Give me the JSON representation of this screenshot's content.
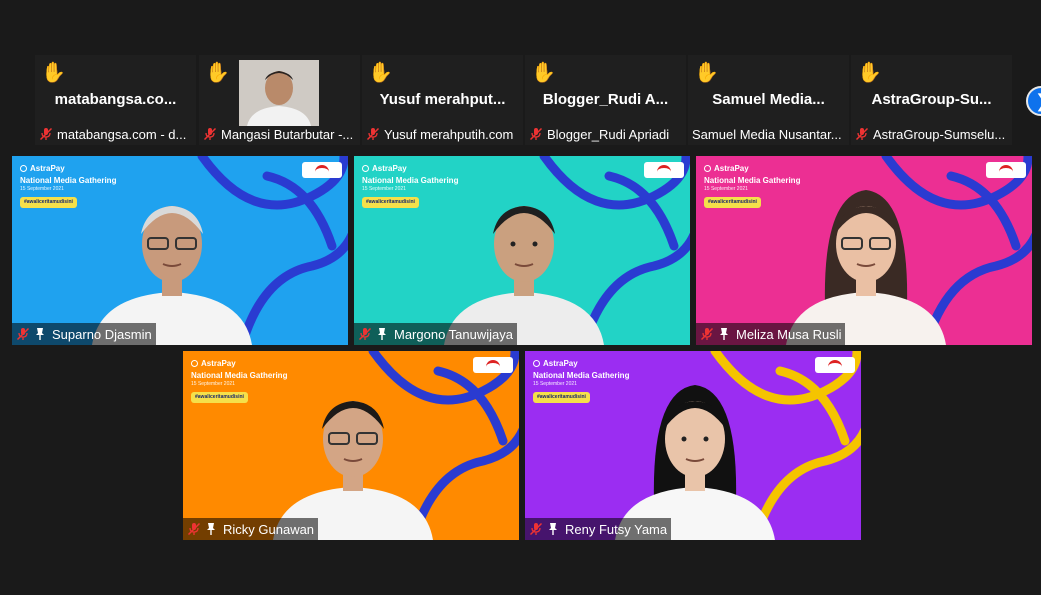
{
  "strip": [
    {
      "big_name": "matabangsa.co...",
      "label": "matabangsa.com - d...",
      "raised_hand": true,
      "has_photo": false
    },
    {
      "big_name": "",
      "label": "Mangasi Butarbutar -...",
      "raised_hand": true,
      "has_photo": true
    },
    {
      "big_name": "Yusuf  merahput...",
      "label": "Yusuf merahputih.com",
      "raised_hand": true,
      "has_photo": false
    },
    {
      "big_name": "Blogger_Rudi  A...",
      "label": "Blogger_Rudi Apriadi",
      "raised_hand": true,
      "has_photo": false
    },
    {
      "big_name": "Samuel  Media...",
      "label": "Samuel Media Nusantar...",
      "raised_hand": true,
      "has_photo": false
    },
    {
      "big_name": "AstraGroup-Su...",
      "label": "AstraGroup-Sumselu...",
      "raised_hand": true,
      "has_photo": false
    }
  ],
  "strip_muted": [
    true,
    true,
    true,
    true,
    false,
    true
  ],
  "hand_icon": "✋",
  "next_icon": "chevron-right-icon",
  "next_glyph": "❯",
  "background": {
    "brand": "AstraPay",
    "event": "National Media Gathering",
    "date": "15 September 2021",
    "hashtag": "#awaliceritamudisini"
  },
  "videos": [
    {
      "name": "Suparno Djasmin",
      "bg": "#1fa2ef",
      "line": "#2a3bd1"
    },
    {
      "name": "Margono Tanuwijaya",
      "bg": "#22d3c6",
      "line": "#2a3bd1"
    },
    {
      "name": "Meliza Musa Rusli",
      "bg": "#ec2f93",
      "line": "#2a3bd1"
    },
    {
      "name": "Ricky Gunawan",
      "bg": "#ff8a00",
      "line": "#2a3bd1"
    },
    {
      "name": "Reny Futsy Yama",
      "bg": "#9b2df2",
      "line": "#f5c400"
    }
  ]
}
